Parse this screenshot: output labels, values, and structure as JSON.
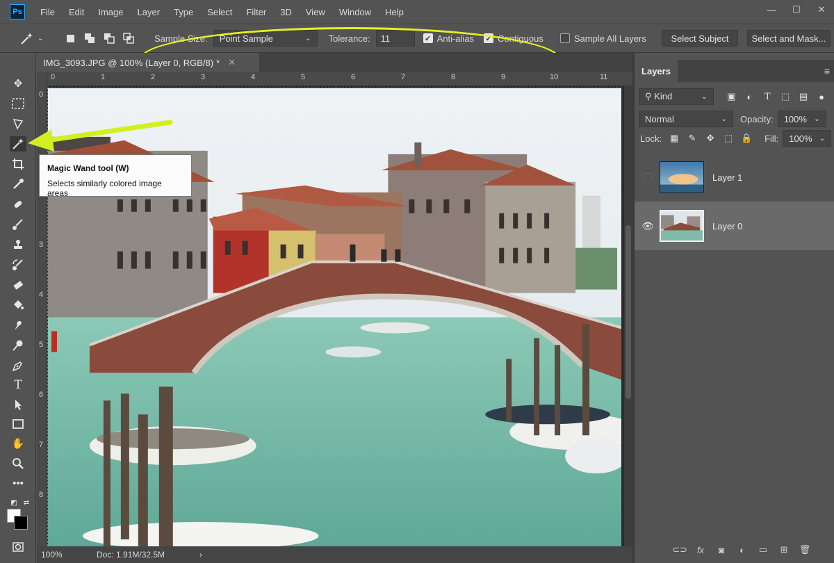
{
  "app": {
    "logo": "Ps"
  },
  "menu": [
    "File",
    "Edit",
    "Image",
    "Layer",
    "Type",
    "Select",
    "Filter",
    "3D",
    "View",
    "Window",
    "Help"
  ],
  "window_controls": {
    "minimize": "—",
    "maximize": "☐",
    "close": "✕"
  },
  "options_bar": {
    "sample_size_label": "Sample Size:",
    "sample_size_value": "Point Sample",
    "tolerance_label": "Tolerance:",
    "tolerance_value": "11",
    "anti_alias_label": "Anti-alias",
    "anti_alias_checked": true,
    "contiguous_label": "Contiguous",
    "contiguous_checked": true,
    "sample_all_layers_label": "Sample All Layers",
    "sample_all_layers_checked": false,
    "select_subject_label": "Select Subject",
    "select_and_mask_label": "Select and Mask..."
  },
  "document": {
    "tab_title": "IMG_3093.JPG @ 100% (Layer 0, RGB/8)",
    "tab_modified": "*",
    "ruler_h": [
      "0",
      "1",
      "2",
      "3",
      "4",
      "5",
      "6",
      "7",
      "8",
      "9",
      "10",
      "11"
    ],
    "ruler_v": [
      "0",
      "1",
      "2",
      "3",
      "4",
      "5",
      "6",
      "7",
      "8"
    ]
  },
  "status": {
    "zoom": "100%",
    "doc_info": "Doc: 1.91M/32.5M"
  },
  "tooltip": {
    "title": "Magic Wand tool (W)",
    "description": "Selects similarly colored image areas"
  },
  "layers_panel": {
    "tab": "Layers",
    "filter_label": "Kind",
    "blend_mode": "Normal",
    "opacity_label": "Opacity:",
    "opacity_value": "100%",
    "lock_label": "Lock:",
    "fill_label": "Fill:",
    "fill_value": "100%",
    "layers": [
      {
        "name": "Layer 1",
        "visible": false,
        "selected": false
      },
      {
        "name": "Layer 0",
        "visible": true,
        "selected": true
      }
    ]
  },
  "colors": {
    "annotation_yellow": "#e3f023",
    "ui_bg": "#535353",
    "canvas_bg": "#2c2c2c"
  }
}
